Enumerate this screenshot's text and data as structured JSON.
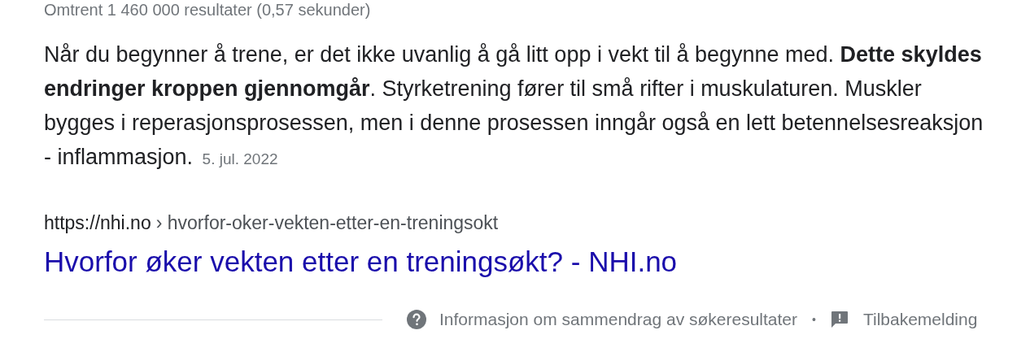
{
  "result_stats": "Omtrent 1 460 000 resultater (0,57 sekunder)",
  "snippet": {
    "text": "Når du begynner å trene, er det ikke uvanlig å gå litt opp i vekt til å begynne med. **Dette skyldes endringer kroppen gjennomgår**. Styrketrening fører til små rifter i muskulaturen. Muskler bygges i reperasjonsprosessen, men i denne prosessen inngår også en lett betennelsesreaksjon - inflammasjon.",
    "date": "5. jul. 2022"
  },
  "result": {
    "url": "https://nhi.no",
    "breadcrumb": "› hvorfor-oker-vekten-etter-en-treningsokt",
    "title": "Hvorfor øker vekten etter en treningsøkt? - NHI.no"
  },
  "footer": {
    "about_link": "Informasjon om sammendrag av søkeresultater",
    "separator": "•",
    "feedback_link": "Tilbakemelding"
  }
}
